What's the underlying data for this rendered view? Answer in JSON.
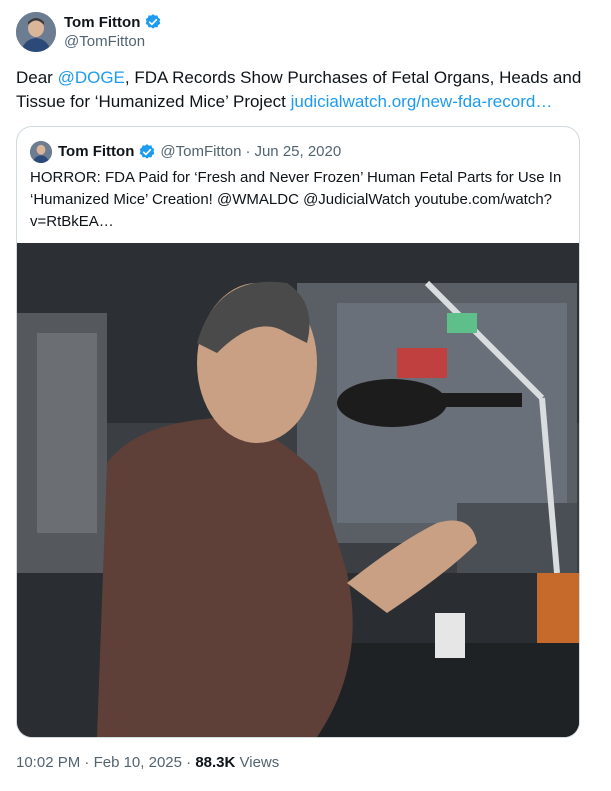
{
  "author": {
    "name": "Tom Fitton",
    "handle": "@TomFitton"
  },
  "tweet": {
    "text_before_mention": "Dear ",
    "mention": "@DOGE",
    "text_after_mention": ", FDA Records Show Purchases of Fetal Organs, Heads and Tissue for ‘Humanized Mice’ Project ",
    "link": "judicialwatch.org/new-fda-record…"
  },
  "quoted": {
    "name": "Tom Fitton",
    "handle": "@TomFitton",
    "separator": "·",
    "date": "Jun 25, 2020",
    "text": "HORROR: FDA Paid for ‘Fresh and Never Frozen’ Human Fetal Parts for Use In ‘Humanized Mice’ Creation! @WMALDC @JudicialWatch youtube.com/watch?v=RtBkEA…"
  },
  "footer": {
    "time": "10:02 PM",
    "sep1": "·",
    "date": "Feb 10, 2025",
    "sep2": "·",
    "views_count": "88.3K",
    "views_label": "Views"
  },
  "colors": {
    "link": "#1d9bf0",
    "verified": "#1d9bf0",
    "muted": "#536471"
  },
  "icons": {
    "verified": "verified-badge-icon"
  }
}
